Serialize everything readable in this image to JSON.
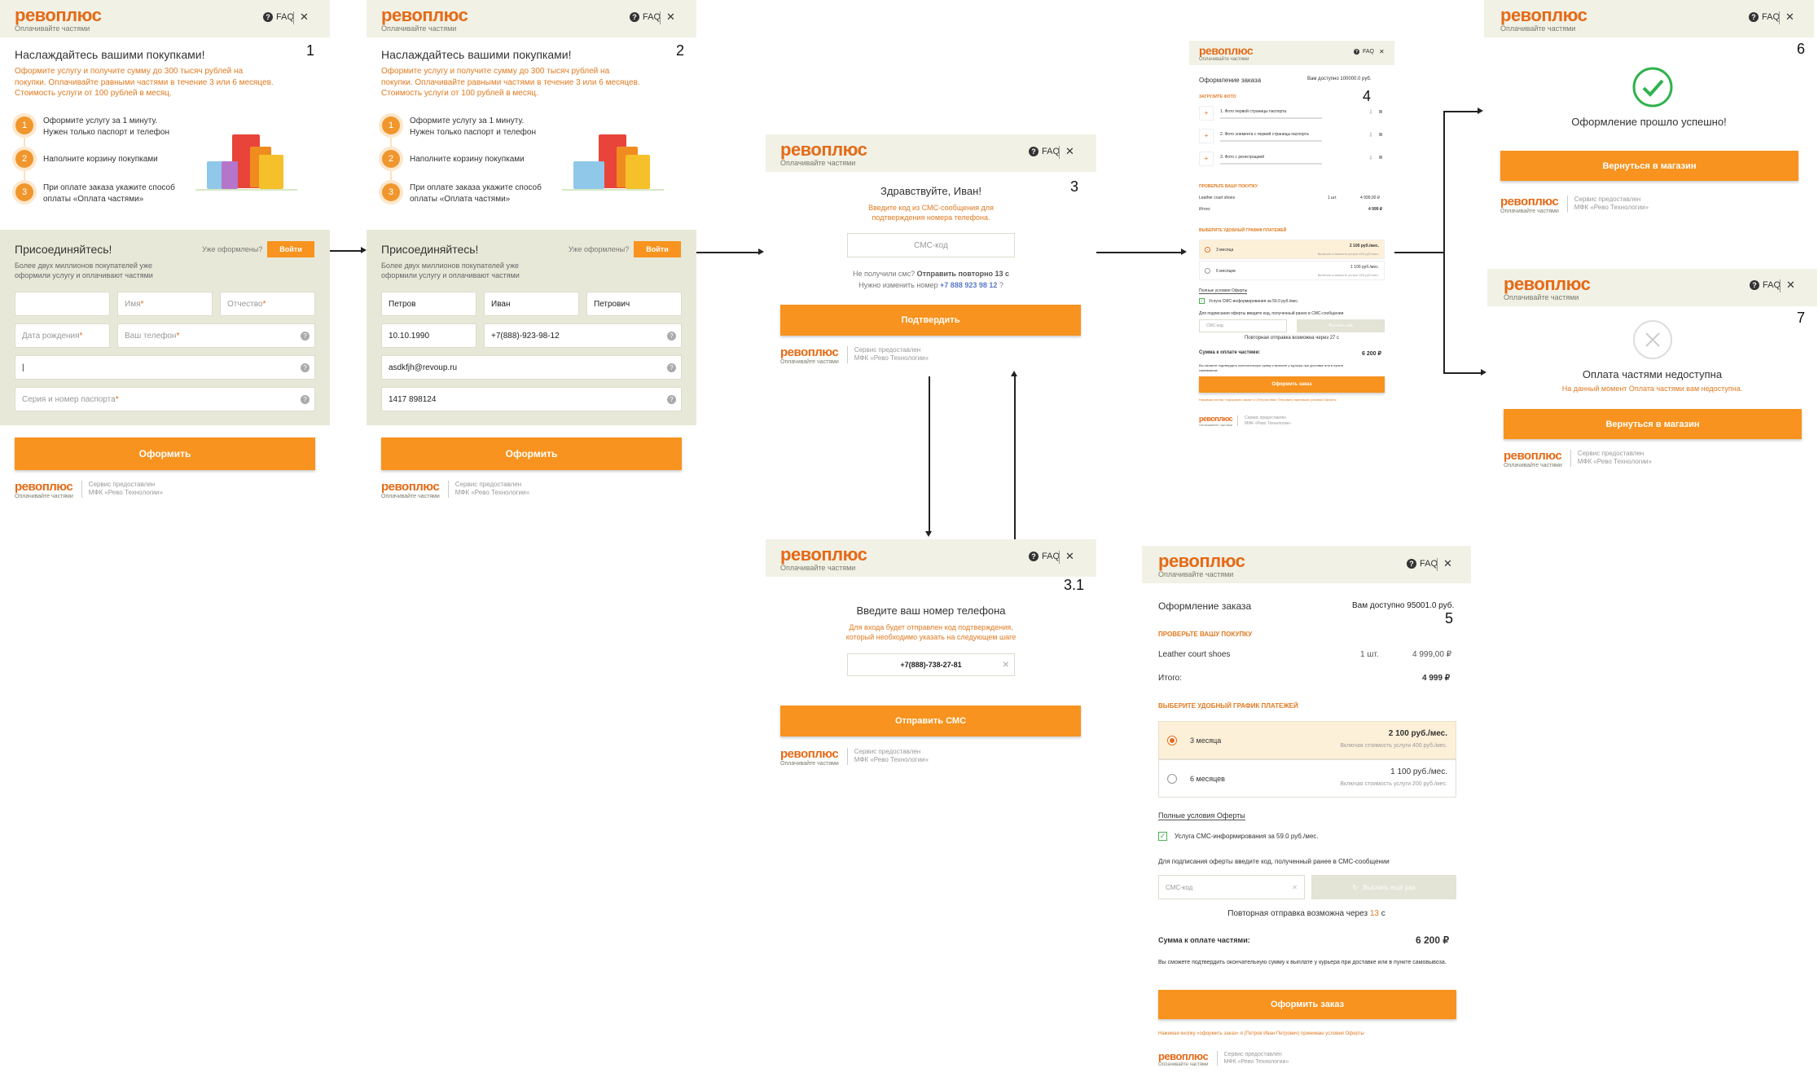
{
  "common": {
    "logo": "ревоплюс",
    "tagline": "Оплачивайте частями",
    "faq": "FAQ",
    "close": "✕",
    "footer_l1": "Сервис предоставлен",
    "footer_l2": "МФК «Рево Технологии»"
  },
  "f1": {
    "num": "1",
    "title": "Наслаждайтесь вашими покупками!",
    "intro": "Оформите услугу и получите сумму до 300 тысяч рублей на покупки. Оплачивайте равными частями в течение 3 или 6 месяцев. Стоимость услуги от 100 рублей в месяц.",
    "steps": [
      {
        "n": "1",
        "t": "Оформите услугу за 1 минуту. Нужен только паспорт и телефон"
      },
      {
        "n": "2",
        "t": "Наполните корзину покупками"
      },
      {
        "n": "3",
        "t": "При оплате заказа укажите способ оплаты «Оплата частями»"
      }
    ],
    "join": "Присоединяйтесь!",
    "join_sub": "Более двух миллионов покупателей уже оформили услугу и оплачивают частями",
    "already": "Уже оформлены?",
    "login": "Войти",
    "f_last": "",
    "f_first": "Имя",
    "f_mid": "Отчество",
    "f_dob": "Дата рождения",
    "f_phone": "Ваш телефон",
    "f_email": "|",
    "f_pass": "Серия и номер паспорта",
    "submit": "Оформить"
  },
  "f2": {
    "num": "2",
    "last": "Петров",
    "first": "Иван",
    "mid": "Петрович",
    "dob": "10.10.1990",
    "phone": "+7(888)-923-98-12",
    "email": "asdkfjh@revoup.ru",
    "pass": "1417 898124"
  },
  "f3": {
    "num": "3",
    "greet": "Здравствуйте, Иван!",
    "sub": "Введите код из СМС-сообщения для подтверждения номера телефона.",
    "sms_ph": "СМС-код",
    "resend_q": "Не получили смс?",
    "resend_a": "Отправить повторно 13 с",
    "change": "Нужно изменить номер",
    "phone": "+7 888 923 98 12",
    "change_end": "?",
    "confirm": "Подтвердить"
  },
  "f31": {
    "num": "3.1",
    "title": "Введите ваш номер телефона",
    "sub": "Для входа будет отправлен код подтверждения, который необходимо указать на следующем шаге",
    "phone": "+7(888)-738-27-81",
    "send": "Отправить СМС"
  },
  "f4": {
    "num": "4",
    "title": "Оформление заказа",
    "avail": "Вам доступно 100000.0 руб.",
    "upload": "ЗАГРУЗИТЕ ФОТО",
    "ph1": "1. Фото первой страницы паспорта",
    "ph2": "2. Фото элемента с первой страницы паспорта",
    "ph3": "3. Фото с регистрацией",
    "check": "ПРОВЕРЬТЕ ВАШУ ПОКУПКУ",
    "item": "Leather court shoes",
    "qty": "1 шт.",
    "price": "4 999,00 ₽",
    "total_l": "Итого:",
    "total": "4 999 ₽",
    "sched": "ВЫБЕРИТЕ УДОБНЫЙ ГРАФИК ПЛАТЕЖЕЙ",
    "m3": "3 месяца",
    "m3p": "2 100 руб./мес.",
    "m3s": "Включая стоимость услуги 400 руб./мес.",
    "m6": "6 месяцев",
    "m6p": "1 100 руб./мес.",
    "m6s": "Включая стоимость услуги 200 руб./мес.",
    "terms": "Полные условия Оферты",
    "smsinfo": "Услуга СМС-информирования за 59.0 руб./мес.",
    "sign": "Для подписания оферты введите код, полученный ранее в СМС-сообщении",
    "smsph": "СМС-код",
    "newcode": "Выслать код",
    "resend": "Повторная отправка возможна через 27 с",
    "sum_l": "Сумма к оплате частями:",
    "sum": "6 200 ₽",
    "note": "Вы сможете подтвердить окончательную сумму к выплате у курьера при доставке или в пункте самовывоза.",
    "order": "Оформить заказ",
    "legal": "Нажимая кнопку «оформить заказ» я (Петров Иван Петрович) принимаю условия Оферты"
  },
  "f5": {
    "num": "5",
    "title": "Оформление заказа",
    "avail": "Вам доступно 95001.0 руб.",
    "check": "ПРОВЕРЬТЕ ВАШУ ПОКУПКУ",
    "item": "Leather court shoes",
    "qty": "1 шт.",
    "price": "4 999,00 ₽",
    "total_l": "Итого:",
    "total": "4 999 ₽",
    "sched": "ВЫБЕРИТЕ УДОБНЫЙ ГРАФИК ПЛАТЕЖЕЙ",
    "m3": "3 месяца",
    "m3p": "2 100 руб./мес.",
    "m3s": "Включая стоимость услуги 400 руб./мес.",
    "m6": "6 месяцев",
    "m6p": "1 100 руб./мес.",
    "m6s": "Включая стоимость услуги 200 руб./мес.",
    "terms": "Полные условия Оферты",
    "smsinfo": "Услуга СМС-информирования за 59.0 руб./мес.",
    "sign": "Для подписания оферты введите код, полученный ранее в СМС-сообщении",
    "smsph": "СМС-код",
    "newcode": "Выслать ещё раз",
    "resend": "Повторная отправка возможна через",
    "resend_n": "13",
    "resend_u": "с",
    "sum_l": "Сумма к оплате частями:",
    "sum": "6 200 ₽",
    "note": "Вы сможете подтвердить окончательную сумму к выплате у курьера при доставке или в пункте самовывоза.",
    "order": "Оформить заказ",
    "legal": "Нажимая кнопку «оформить заказ» я (Петров Иван Петрович) принимаю условия Оферты"
  },
  "f6": {
    "num": "6",
    "msg": "Оформление прошло успешно!",
    "back": "Вернуться в магазин"
  },
  "f7": {
    "num": "7",
    "msg": "Оплата частями недоступна",
    "sub": "На данный момент Оплата частями вам недоступна.",
    "back": "Вернуться в магазин"
  },
  "colors": {
    "orange": "#f7931e",
    "brand": "#e56a16",
    "header": "#f1f1e6",
    "band": "#e8e8d8",
    "success": "#2fb24c"
  }
}
